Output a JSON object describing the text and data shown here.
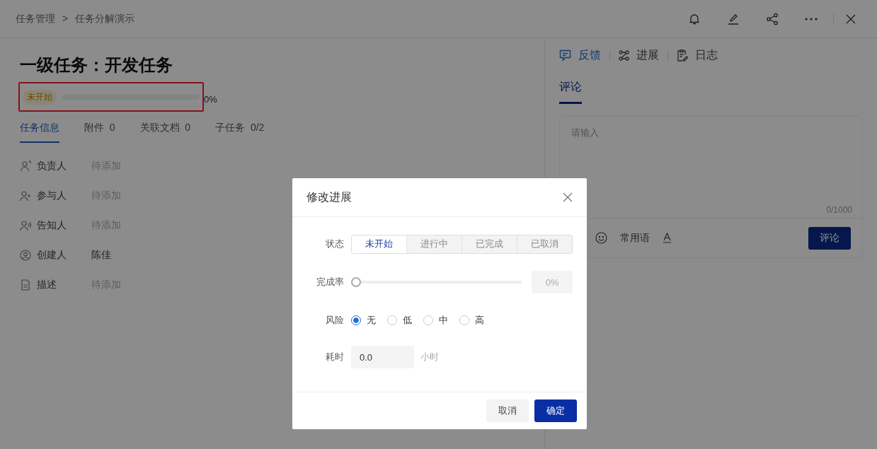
{
  "breadcrumb": {
    "items": [
      "任务管理",
      "任务分解演示"
    ],
    "separator": ">"
  },
  "task": {
    "title": "一级任务：开发任务",
    "status": "未开始",
    "level": 0,
    "reading": "0%"
  },
  "tabs": [
    {
      "label": "任务信息",
      "selected": true
    },
    {
      "label": "附件",
      "count": "0",
      "selected": false
    },
    {
      "label": "关联文档",
      "count": "0",
      "selected": false
    },
    {
      "label": "子任务",
      "count": "0/2",
      "selected": false
    }
  ],
  "fields": [
    {
      "kind": "owner",
      "label": "负责人",
      "value": "待添加",
      "empty": true
    },
    {
      "kind": "participant",
      "label": "参与人",
      "value": "待添加",
      "empty": true
    },
    {
      "kind": "notify",
      "label": "告知人",
      "value": "待添加",
      "empty": true
    },
    {
      "kind": "creator",
      "label": "创建人",
      "value": "陈佳",
      "empty": false
    },
    {
      "kind": "description",
      "label": "描述",
      "value": "待添加",
      "empty": true
    }
  ],
  "side_tabs": [
    {
      "kind": "feedback",
      "label": "反馈",
      "selected": true
    },
    {
      "kind": "progress",
      "label": "进展",
      "selected": false
    },
    {
      "kind": "log",
      "label": "日志",
      "selected": false
    }
  ],
  "comment": {
    "tab": "评论",
    "placeholder": "请输入",
    "counter": "0/1000",
    "phrases": "常用语",
    "submit": "评论"
  },
  "dialog": {
    "title": "修改进展",
    "status": {
      "label": "状态",
      "options": [
        {
          "label": "未开始",
          "selected": true
        },
        {
          "label": "进行中",
          "selected": false
        },
        {
          "label": "已完成",
          "selected": false
        },
        {
          "label": "已取消",
          "selected": false
        }
      ]
    },
    "completion": {
      "label": "完成率",
      "level": 0,
      "reading": "0%"
    },
    "risk": {
      "label": "风险",
      "options": [
        {
          "label": "无",
          "selected": true
        },
        {
          "label": "低",
          "selected": false
        },
        {
          "label": "中",
          "selected": false
        },
        {
          "label": "高",
          "selected": false
        }
      ]
    },
    "duration": {
      "label": "耗时",
      "value": "0.0",
      "unit": "小时"
    },
    "cancel": "取消",
    "confirm": "确定"
  }
}
